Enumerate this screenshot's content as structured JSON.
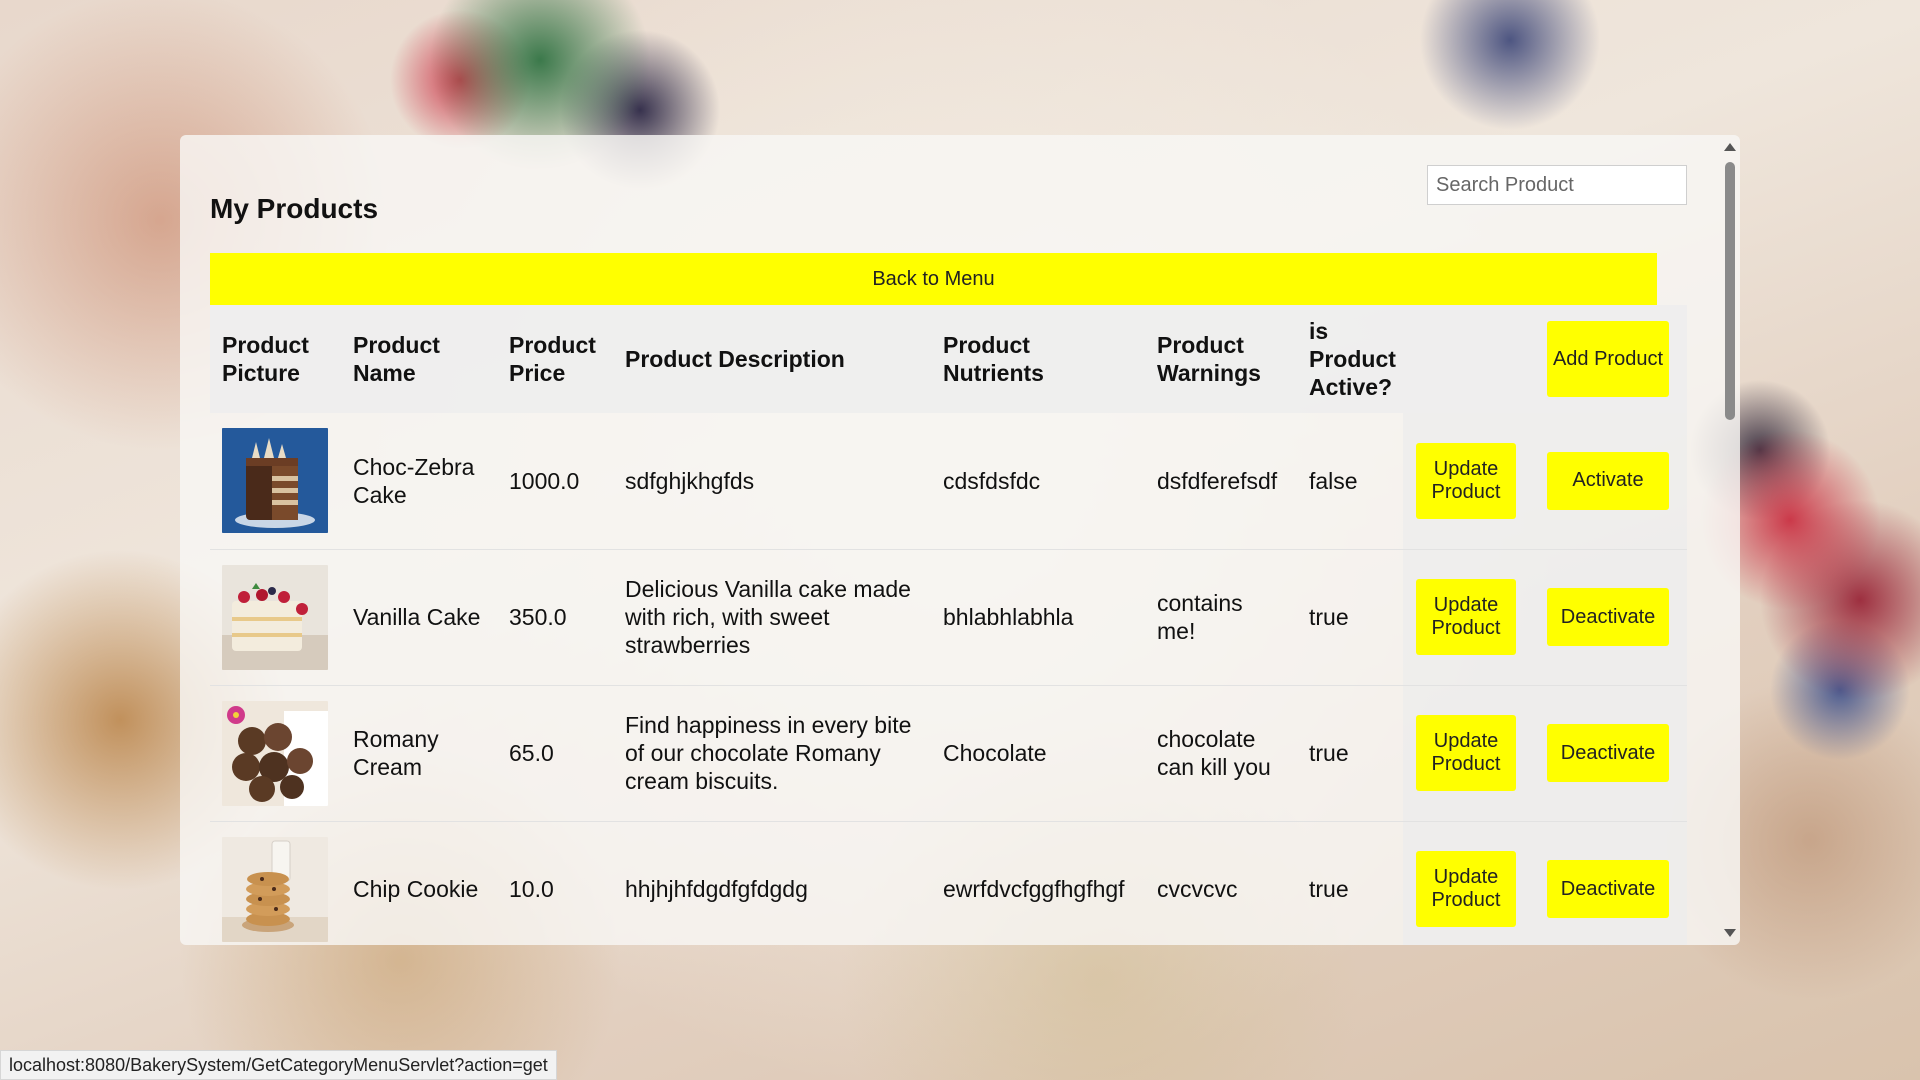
{
  "page": {
    "title": "My Products",
    "search_placeholder": "Search Product",
    "back_label": "Back to Menu"
  },
  "table": {
    "headers": {
      "picture": "Product Picture",
      "name": "Product Name",
      "price": "Product Price",
      "description": "Product Description",
      "nutrients": "Product Nutrients",
      "warnings": "Product Warnings",
      "active": "is Product Active?",
      "add_label": "Add Product"
    },
    "rows": [
      {
        "image_icon": "chocolate-zebra-cake-photo",
        "name": "Choc-Zebra Cake",
        "price": "1000.0",
        "description": "sdfghjkhgfds",
        "nutrients": "cdsfdsfdc",
        "warnings": "dsfdferefsdf",
        "active": "false",
        "update_label": "Update Product",
        "toggle_label": "Activate"
      },
      {
        "image_icon": "vanilla-cake-photo",
        "name": "Vanilla Cake",
        "price": "350.0",
        "description": "Delicious Vanilla cake made with rich, with sweet strawberries",
        "nutrients": "bhlabhlabhla",
        "warnings": "contains me!",
        "active": "true",
        "update_label": "Update Product",
        "toggle_label": "Deactivate"
      },
      {
        "image_icon": "romany-cream-biscuits-photo",
        "name": "Romany Cream",
        "price": "65.0",
        "description": "Find happiness in every bite of our chocolate Romany cream biscuits.",
        "nutrients": "Chocolate",
        "warnings": "chocolate can kill you",
        "active": "true",
        "update_label": "Update Product",
        "toggle_label": "Deactivate"
      },
      {
        "image_icon": "chip-cookie-photo",
        "name": "Chip Cookie",
        "price": "10.0",
        "description": "hhjhjhfdgdfgfdgdg",
        "nutrients": "ewrfdvcfggfhgfhgf",
        "warnings": "cvcvcvc",
        "active": "true",
        "update_label": "Update Product",
        "toggle_label": "Deactivate"
      }
    ]
  },
  "status_bar": {
    "url": "localhost:8080/BakerySystem/GetCategoryMenuServlet?action=get"
  },
  "colors": {
    "button_yellow": "#ffff00",
    "panel_bg": "#f8f6f4"
  }
}
